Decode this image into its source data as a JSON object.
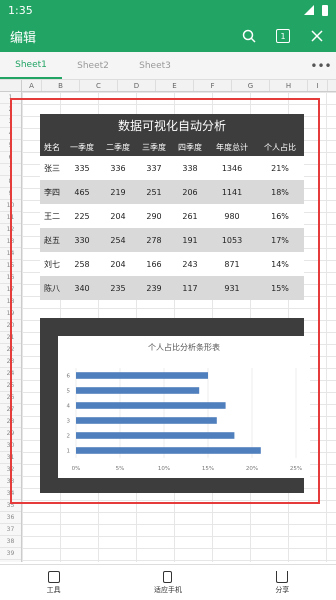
{
  "status": {
    "time": "1:35"
  },
  "appbar": {
    "title": "编辑",
    "page_count": "1"
  },
  "tabs": [
    "Sheet1",
    "Sheet2",
    "Sheet3"
  ],
  "more_icon": "more-horizontal-icon",
  "col_headers": [
    "A",
    "B",
    "C",
    "D",
    "E",
    "F",
    "G",
    "H",
    "I"
  ],
  "row_headers": [
    "1",
    "2",
    "3",
    "4",
    "5",
    "6",
    "7",
    "8",
    "9",
    "10",
    "11",
    "12",
    "13",
    "14",
    "15",
    "16",
    "17",
    "18",
    "19",
    "20",
    "21",
    "22",
    "23",
    "24",
    "25",
    "26",
    "27",
    "28",
    "29",
    "30",
    "31",
    "32",
    "33",
    "34",
    "35",
    "36",
    "37",
    "38",
    "39"
  ],
  "table": {
    "title": "数据可视化自动分析",
    "headers": [
      "姓名",
      "一季度",
      "二季度",
      "三季度",
      "四季度",
      "年度总计",
      "个人占比"
    ],
    "rows": [
      [
        "张三",
        "335",
        "336",
        "337",
        "338",
        "1346",
        "21%"
      ],
      [
        "李四",
        "465",
        "219",
        "251",
        "206",
        "1141",
        "18%"
      ],
      [
        "王二",
        "225",
        "204",
        "290",
        "261",
        "980",
        "16%"
      ],
      [
        "赵五",
        "330",
        "254",
        "278",
        "191",
        "1053",
        "17%"
      ],
      [
        "刘七",
        "258",
        "204",
        "166",
        "243",
        "871",
        "14%"
      ],
      [
        "陈八",
        "340",
        "235",
        "239",
        "117",
        "931",
        "15%"
      ]
    ]
  },
  "chart_data": {
    "type": "bar",
    "title": "个人占比分析条形表",
    "categories": [
      "1",
      "2",
      "3",
      "4",
      "5",
      "6"
    ],
    "values": [
      0.21,
      0.18,
      0.16,
      0.17,
      0.14,
      0.15
    ],
    "xlim": [
      0,
      0.25
    ],
    "xticks": [
      "0%",
      "5%",
      "10%",
      "15%",
      "20%",
      "25%"
    ],
    "orientation": "horizontal",
    "bar_color": "#4f7fbd"
  },
  "bottom": {
    "tools": "工具",
    "fit": "适应手机",
    "share": "分享"
  },
  "colors": {
    "accent": "#21a464",
    "selection": "#e63b3b",
    "dark": "#3d3d3d"
  }
}
